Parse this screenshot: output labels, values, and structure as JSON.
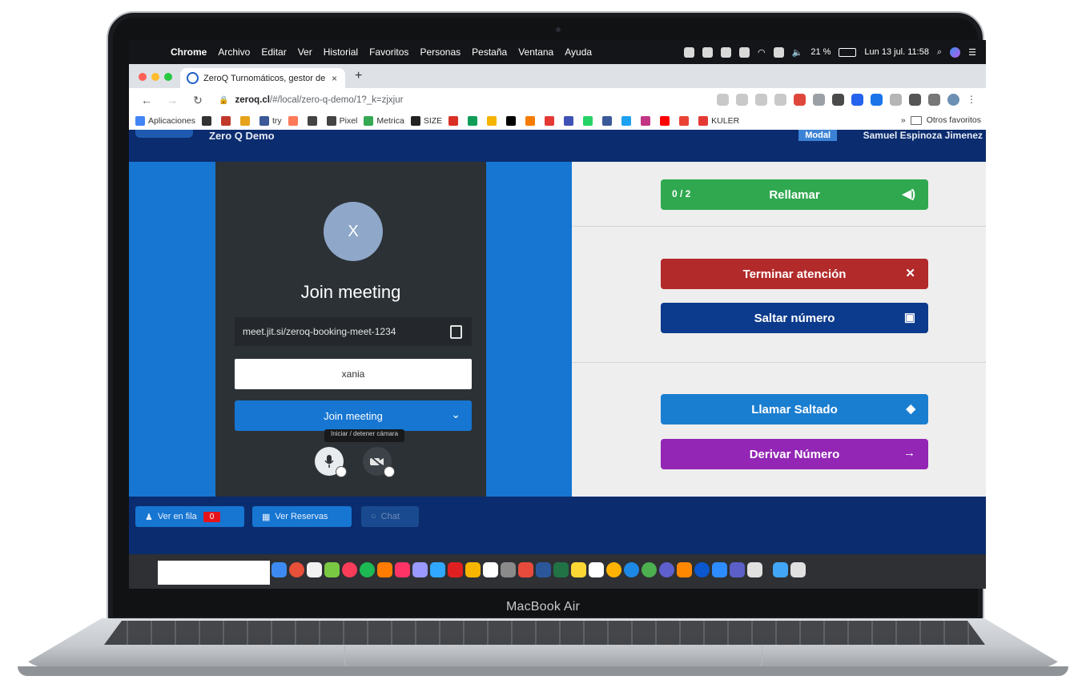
{
  "device": {
    "label": "MacBook Air"
  },
  "menubar": {
    "app": "Chrome",
    "items": [
      "Archivo",
      "Editar",
      "Ver",
      "Historial",
      "Favoritos",
      "Personas",
      "Pestaña",
      "Ventana",
      "Ayuda"
    ],
    "battery": "21 %",
    "clock": "Lun 13 jul.  11:58"
  },
  "browser": {
    "tab_title": "ZeroQ Turnomáticos, gestor de",
    "tab_close": "×",
    "new_tab": "+",
    "url_domain": "zeroq.cl",
    "url_path": "/#/local/zero-q-demo/1?_k=zjxjur",
    "bookmarks": [
      "Aplicaciones",
      "try",
      "Pixel",
      "Metrica",
      "SIZE",
      "KULER"
    ],
    "bookmarks_more": "»",
    "other_bookmarks": "Otros favoritos"
  },
  "app": {
    "name": "Zero Q Demo",
    "role": "Modal",
    "user": "Samuel Espinoza Jimenez"
  },
  "meeting": {
    "avatar_initial": "X",
    "title": "Join meeting",
    "url": "meet.jit.si/zeroq-booking-meet-1234",
    "name_value": "xania",
    "join_label": "Join meeting",
    "tooltip": "Iniciar / detener cámara"
  },
  "actions": {
    "recall_count": "0 / 2",
    "recall": "Rellamar",
    "finish": "Terminar atención",
    "skip": "Saltar número",
    "call_skipped": "Llamar Saltado",
    "transfer": "Derivar Número"
  },
  "footer": {
    "queue_label": "Ver en fila",
    "queue_count": "0",
    "reservations_label": "Ver Reservas",
    "chat_label": "Chat"
  },
  "colors": {
    "app_navy": "#0b2c6e",
    "panel_blue": "#1676d2",
    "green": "#2fa84f",
    "red": "#b22a2a",
    "dark_blue": "#0c3a8c",
    "light_blue": "#1a7ed0",
    "purple": "#9326b5"
  }
}
